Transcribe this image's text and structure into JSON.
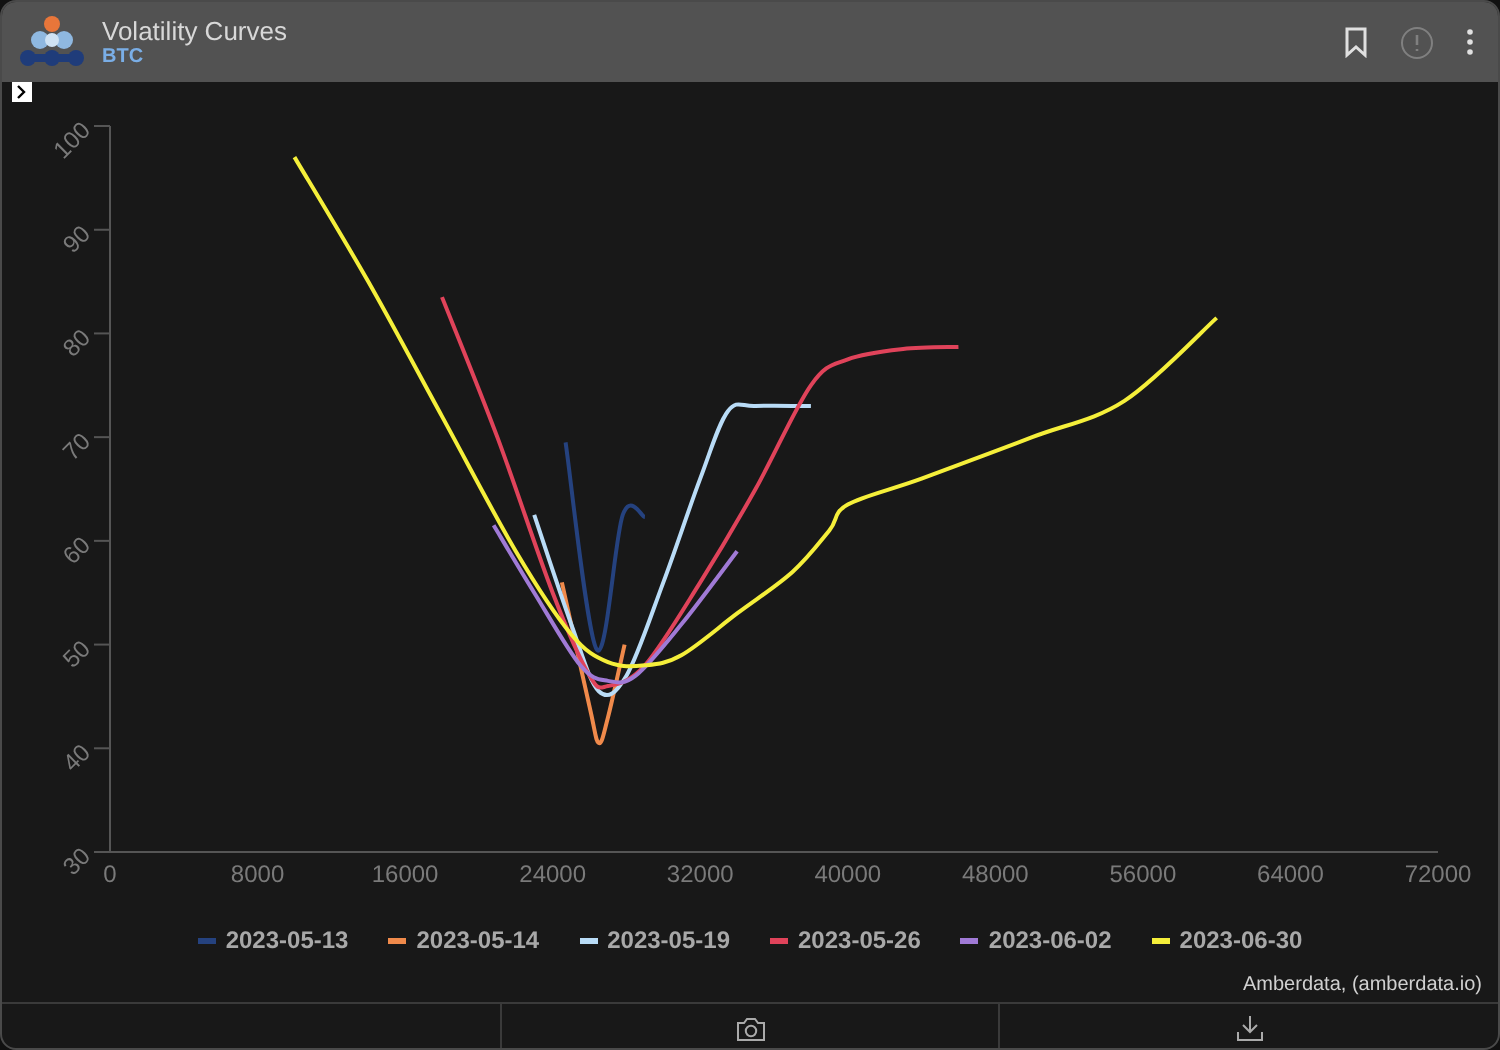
{
  "header": {
    "title": "Volatility Curves",
    "subtitle": "BTC"
  },
  "chart": {
    "chart_data": {
      "type": "line",
      "xlim": [
        0,
        72000
      ],
      "ylim": [
        30,
        100
      ],
      "xticks": [
        0,
        8000,
        16000,
        24000,
        32000,
        40000,
        48000,
        56000,
        64000,
        72000
      ],
      "yticks": [
        30,
        40,
        50,
        60,
        70,
        80,
        90,
        100
      ],
      "series": [
        {
          "name": "2023-05-13",
          "color": "#25427f",
          "x": [
            24700,
            26400,
            27800,
            29000
          ],
          "values": [
            69.5,
            49.5,
            62.5,
            62.3
          ]
        },
        {
          "name": "2023-05-14",
          "color": "#f08a4b",
          "x": [
            24500,
            26000,
            26500,
            27000,
            27900
          ],
          "values": [
            56,
            44,
            40.5,
            43,
            50
          ]
        },
        {
          "name": "2023-05-19",
          "color": "#b9dcf7",
          "x": [
            23000,
            25000,
            26500,
            28000,
            30000,
            32000,
            33500,
            35000,
            38000
          ],
          "values": [
            62.5,
            52,
            45.5,
            47,
            56,
            66,
            72.5,
            73,
            73
          ]
        },
        {
          "name": "2023-05-26",
          "color": "#e0435a",
          "x": [
            18000,
            21000,
            24000,
            26000,
            27000,
            29000,
            32000,
            35000,
            38000,
            40000,
            43000,
            46000
          ],
          "values": [
            83.5,
            70,
            55,
            47,
            46,
            48,
            56,
            65,
            75,
            77.5,
            78.5,
            78.7
          ]
        },
        {
          "name": "2023-06-02",
          "color": "#a07ad6",
          "x": [
            20800,
            23000,
            25500,
            27000,
            28500,
            31000,
            34000
          ],
          "values": [
            61.5,
            55,
            48,
            46.5,
            47,
            52,
            59
          ]
        },
        {
          "name": "2023-06-30",
          "color": "#f5ef3a",
          "x": [
            10000,
            14000,
            18000,
            22000,
            25000,
            27000,
            29000,
            31000,
            34000,
            37000,
            39000,
            40000,
            44000,
            50000,
            55000,
            60000
          ],
          "values": [
            97,
            85,
            72,
            59,
            51,
            48.3,
            48,
            49,
            53,
            57,
            61,
            63.5,
            66,
            70,
            73.5,
            81.5
          ]
        }
      ]
    },
    "source": "Amberdata, (amberdata.io)"
  }
}
